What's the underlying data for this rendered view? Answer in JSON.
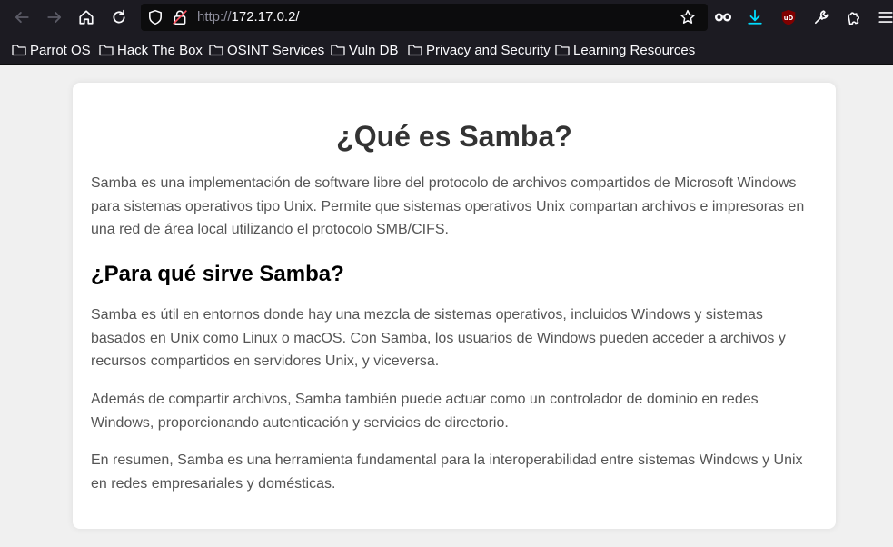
{
  "browser": {
    "url_protocol": "http://",
    "url_host": "172.17.0.2/",
    "bookmarks": [
      {
        "label": "Parrot OS"
      },
      {
        "label": "Hack The Box"
      },
      {
        "label": "OSINT Services"
      },
      {
        "label": "Vuln DB"
      },
      {
        "label": "Privacy and Security"
      },
      {
        "label": "Learning Resources"
      }
    ],
    "ublock_badge": "uD"
  },
  "page": {
    "title": "¿Qué es Samba?",
    "intro": "Samba es una implementación de software libre del protocolo de archivos compartidos de Microsoft Windows para sistemas operativos tipo Unix. Permite que sistemas operativos Unix compartan archivos e impresoras en una red de área local utilizando el protocolo SMB/CIFS.",
    "subtitle": "¿Para qué sirve Samba?",
    "paragraphs": [
      "Samba es útil en entornos donde hay una mezcla de sistemas operativos, incluidos Windows y sistemas basados en Unix como Linux o macOS. Con Samba, los usuarios de Windows pueden acceder a archivos y recursos compartidos en servidores Unix, y viceversa.",
      "Además de compartir archivos, Samba también puede actuar como un controlador de dominio en redes Windows, proporcionando autenticación y servicios de directorio.",
      "En resumen, Samba es una herramienta fundamental para la interoperabilidad entre sistemas Windows y Unix en redes empresariales y domésticas."
    ]
  },
  "colors": {
    "chrome_bg": "#1c1b22",
    "page_bg": "#f0f0f0",
    "card_bg": "#ffffff",
    "heading": "#333333",
    "text": "#555555",
    "download_accent": "#00ddff",
    "ublock_red": "#800000"
  }
}
